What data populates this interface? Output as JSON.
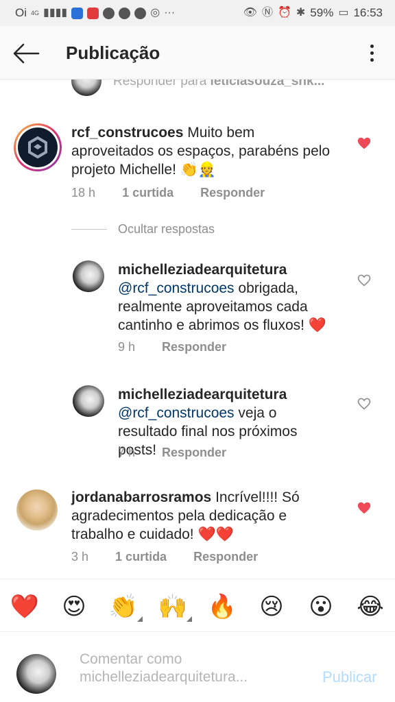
{
  "status_bar": {
    "carrier": "Oi",
    "network": "4G",
    "battery": "59%",
    "time": "16:53"
  },
  "header": {
    "title": "Publicação",
    "back_icon": "back-arrow-icon",
    "more_icon": "more-vertical-icon"
  },
  "partial_reply": {
    "text": "Responder para",
    "user": "leticiasouza_snk..."
  },
  "comments": [
    {
      "username": "rcf_construcoes",
      "text": "Muito bem aproveitados os espaços, parabéns pelo projeto Michelle! 👏👷",
      "time": "18 h",
      "likes": "1 curtida",
      "reply_label": "Responder",
      "liked": true
    },
    {
      "username": "michelleziadearquitetura",
      "mention": "@rcf_construcoes",
      "text": "obrigada, realmente aproveitamos cada cantinho e abrimos os fluxos! ❤️",
      "time": "9 h",
      "reply_label": "Responder",
      "liked": false
    },
    {
      "username": "michelleziadearquitetura",
      "mention": "@rcf_construcoes",
      "text": "veja o resultado final nos próximos posts!",
      "time": "7 h",
      "reply_label": "Responder",
      "liked": false
    },
    {
      "username": "jordanabarrosramos",
      "text": "Incrível!!!! Só agradecimentos pela dedicação e trabalho e cuidado! ❤️❤️",
      "time": "3 h",
      "likes": "1 curtida",
      "reply_label": "Responder",
      "liked": true
    }
  ],
  "hide_replies_label": "Ocultar respostas",
  "emoji_bar": [
    "❤️",
    "😍",
    "👏",
    "🙌",
    "🔥",
    "😢",
    "😮",
    "😂"
  ],
  "composer": {
    "placeholder_line1": "Comentar como",
    "placeholder_line2": "michelleziadearquitetura...",
    "publish_label": "Publicar"
  },
  "colors": {
    "like_red": "#ed4956",
    "mention_blue": "#00376b",
    "publish_disabled": "#b3dbff",
    "meta_gray": "#8e8e8e"
  }
}
